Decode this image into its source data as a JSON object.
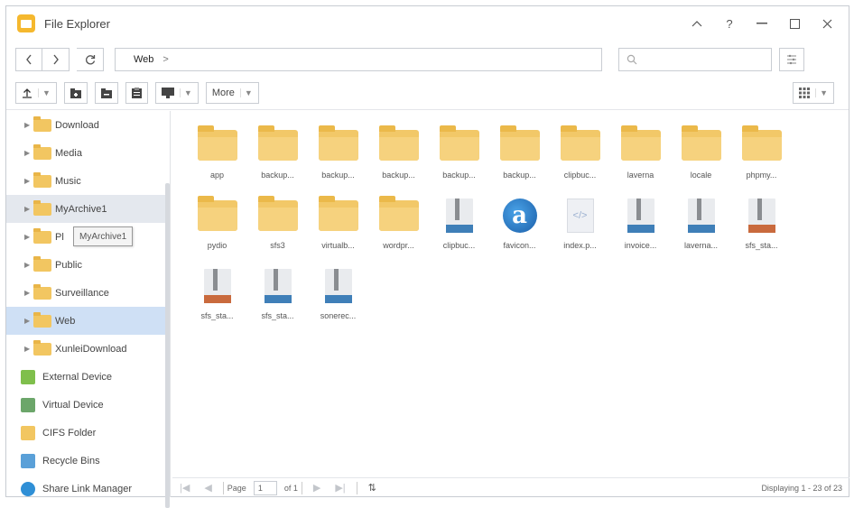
{
  "window": {
    "title": "File Explorer"
  },
  "nav": {
    "back_icon": "chevron-left-icon",
    "forward_icon": "chevron-right-icon",
    "refresh_icon": "refresh-icon",
    "path": "Web",
    "path_sep": ">",
    "search_placeholder": "",
    "filter_icon": "filter-icon"
  },
  "toolbar": {
    "more_label": "More"
  },
  "sidebar": {
    "items": [
      {
        "label": "Download",
        "type": "folder"
      },
      {
        "label": "Media",
        "type": "folder"
      },
      {
        "label": "Music",
        "type": "folder"
      },
      {
        "label": "MyArchive1",
        "type": "folder"
      },
      {
        "label": "Pl",
        "type": "folder"
      },
      {
        "label": "Public",
        "type": "folder"
      },
      {
        "label": "Surveillance",
        "type": "folder"
      },
      {
        "label": "Web",
        "type": "folder"
      },
      {
        "label": "XunleiDownload",
        "type": "folder"
      }
    ],
    "roots": [
      {
        "label": "External Device",
        "color": "#7fbf4c"
      },
      {
        "label": "Virtual Device",
        "color": "#6ca66a"
      },
      {
        "label": "CIFS Folder",
        "color": "#f2c661"
      },
      {
        "label": "Recycle Bins",
        "color": "#5aa0d8"
      },
      {
        "label": "Share Link Manager",
        "color": "#2f8fd6"
      }
    ],
    "tooltip": "MyArchive1"
  },
  "files": [
    {
      "name": "app",
      "kind": "folder"
    },
    {
      "name": "backup...",
      "kind": "folder"
    },
    {
      "name": "backup...",
      "kind": "folder"
    },
    {
      "name": "backup...",
      "kind": "folder"
    },
    {
      "name": "backup...",
      "kind": "folder"
    },
    {
      "name": "backup...",
      "kind": "folder"
    },
    {
      "name": "clipbuc...",
      "kind": "folder"
    },
    {
      "name": "laverna",
      "kind": "folder"
    },
    {
      "name": "locale",
      "kind": "folder"
    },
    {
      "name": "phpmy...",
      "kind": "folder"
    },
    {
      "name": "pydio",
      "kind": "folder"
    },
    {
      "name": "sfs3",
      "kind": "folder"
    },
    {
      "name": "virtualb...",
      "kind": "folder"
    },
    {
      "name": "wordpr...",
      "kind": "folder"
    },
    {
      "name": "clipbuc...",
      "kind": "zip-blue"
    },
    {
      "name": "favicon...",
      "kind": "favicon"
    },
    {
      "name": "index.p...",
      "kind": "code"
    },
    {
      "name": "invoice...",
      "kind": "zip-blue"
    },
    {
      "name": "laverna...",
      "kind": "zip-blue"
    },
    {
      "name": "sfs_sta...",
      "kind": "zip-red"
    },
    {
      "name": "sfs_sta...",
      "kind": "zip-red"
    },
    {
      "name": "sfs_sta...",
      "kind": "zip-blue"
    },
    {
      "name": "sonerec...",
      "kind": "zip-blue"
    }
  ],
  "pager": {
    "page_label": "Page",
    "page_value": "1",
    "of_label": "of 1",
    "display_text": "Displaying 1 - 23 of 23"
  }
}
